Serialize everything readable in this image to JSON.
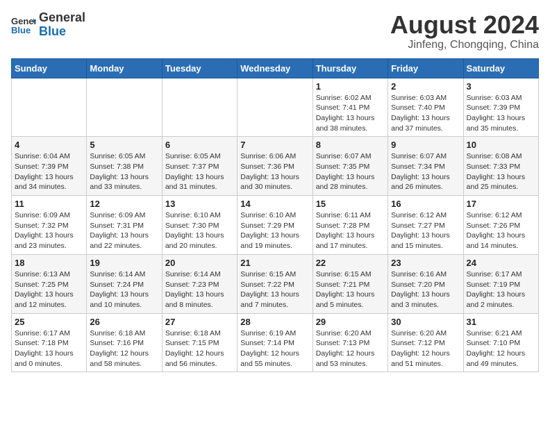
{
  "logo": {
    "general": "General",
    "blue": "Blue"
  },
  "header": {
    "title": "August 2024",
    "subtitle": "Jinfeng, Chongqing, China"
  },
  "weekdays": [
    "Sunday",
    "Monday",
    "Tuesday",
    "Wednesday",
    "Thursday",
    "Friday",
    "Saturday"
  ],
  "weeks": [
    [
      {
        "day": "",
        "info": ""
      },
      {
        "day": "",
        "info": ""
      },
      {
        "day": "",
        "info": ""
      },
      {
        "day": "",
        "info": ""
      },
      {
        "day": "1",
        "info": "Sunrise: 6:02 AM\nSunset: 7:41 PM\nDaylight: 13 hours\nand 38 minutes."
      },
      {
        "day": "2",
        "info": "Sunrise: 6:03 AM\nSunset: 7:40 PM\nDaylight: 13 hours\nand 37 minutes."
      },
      {
        "day": "3",
        "info": "Sunrise: 6:03 AM\nSunset: 7:39 PM\nDaylight: 13 hours\nand 35 minutes."
      }
    ],
    [
      {
        "day": "4",
        "info": "Sunrise: 6:04 AM\nSunset: 7:39 PM\nDaylight: 13 hours\nand 34 minutes."
      },
      {
        "day": "5",
        "info": "Sunrise: 6:05 AM\nSunset: 7:38 PM\nDaylight: 13 hours\nand 33 minutes."
      },
      {
        "day": "6",
        "info": "Sunrise: 6:05 AM\nSunset: 7:37 PM\nDaylight: 13 hours\nand 31 minutes."
      },
      {
        "day": "7",
        "info": "Sunrise: 6:06 AM\nSunset: 7:36 PM\nDaylight: 13 hours\nand 30 minutes."
      },
      {
        "day": "8",
        "info": "Sunrise: 6:07 AM\nSunset: 7:35 PM\nDaylight: 13 hours\nand 28 minutes."
      },
      {
        "day": "9",
        "info": "Sunrise: 6:07 AM\nSunset: 7:34 PM\nDaylight: 13 hours\nand 26 minutes."
      },
      {
        "day": "10",
        "info": "Sunrise: 6:08 AM\nSunset: 7:33 PM\nDaylight: 13 hours\nand 25 minutes."
      }
    ],
    [
      {
        "day": "11",
        "info": "Sunrise: 6:09 AM\nSunset: 7:32 PM\nDaylight: 13 hours\nand 23 minutes."
      },
      {
        "day": "12",
        "info": "Sunrise: 6:09 AM\nSunset: 7:31 PM\nDaylight: 13 hours\nand 22 minutes."
      },
      {
        "day": "13",
        "info": "Sunrise: 6:10 AM\nSunset: 7:30 PM\nDaylight: 13 hours\nand 20 minutes."
      },
      {
        "day": "14",
        "info": "Sunrise: 6:10 AM\nSunset: 7:29 PM\nDaylight: 13 hours\nand 19 minutes."
      },
      {
        "day": "15",
        "info": "Sunrise: 6:11 AM\nSunset: 7:28 PM\nDaylight: 13 hours\nand 17 minutes."
      },
      {
        "day": "16",
        "info": "Sunrise: 6:12 AM\nSunset: 7:27 PM\nDaylight: 13 hours\nand 15 minutes."
      },
      {
        "day": "17",
        "info": "Sunrise: 6:12 AM\nSunset: 7:26 PM\nDaylight: 13 hours\nand 14 minutes."
      }
    ],
    [
      {
        "day": "18",
        "info": "Sunrise: 6:13 AM\nSunset: 7:25 PM\nDaylight: 13 hours\nand 12 minutes."
      },
      {
        "day": "19",
        "info": "Sunrise: 6:14 AM\nSunset: 7:24 PM\nDaylight: 13 hours\nand 10 minutes."
      },
      {
        "day": "20",
        "info": "Sunrise: 6:14 AM\nSunset: 7:23 PM\nDaylight: 13 hours\nand 8 minutes."
      },
      {
        "day": "21",
        "info": "Sunrise: 6:15 AM\nSunset: 7:22 PM\nDaylight: 13 hours\nand 7 minutes."
      },
      {
        "day": "22",
        "info": "Sunrise: 6:15 AM\nSunset: 7:21 PM\nDaylight: 13 hours\nand 5 minutes."
      },
      {
        "day": "23",
        "info": "Sunrise: 6:16 AM\nSunset: 7:20 PM\nDaylight: 13 hours\nand 3 minutes."
      },
      {
        "day": "24",
        "info": "Sunrise: 6:17 AM\nSunset: 7:19 PM\nDaylight: 13 hours\nand 2 minutes."
      }
    ],
    [
      {
        "day": "25",
        "info": "Sunrise: 6:17 AM\nSunset: 7:18 PM\nDaylight: 13 hours\nand 0 minutes."
      },
      {
        "day": "26",
        "info": "Sunrise: 6:18 AM\nSunset: 7:16 PM\nDaylight: 12 hours\nand 58 minutes."
      },
      {
        "day": "27",
        "info": "Sunrise: 6:18 AM\nSunset: 7:15 PM\nDaylight: 12 hours\nand 56 minutes."
      },
      {
        "day": "28",
        "info": "Sunrise: 6:19 AM\nSunset: 7:14 PM\nDaylight: 12 hours\nand 55 minutes."
      },
      {
        "day": "29",
        "info": "Sunrise: 6:20 AM\nSunset: 7:13 PM\nDaylight: 12 hours\nand 53 minutes."
      },
      {
        "day": "30",
        "info": "Sunrise: 6:20 AM\nSunset: 7:12 PM\nDaylight: 12 hours\nand 51 minutes."
      },
      {
        "day": "31",
        "info": "Sunrise: 6:21 AM\nSunset: 7:10 PM\nDaylight: 12 hours\nand 49 minutes."
      }
    ]
  ]
}
